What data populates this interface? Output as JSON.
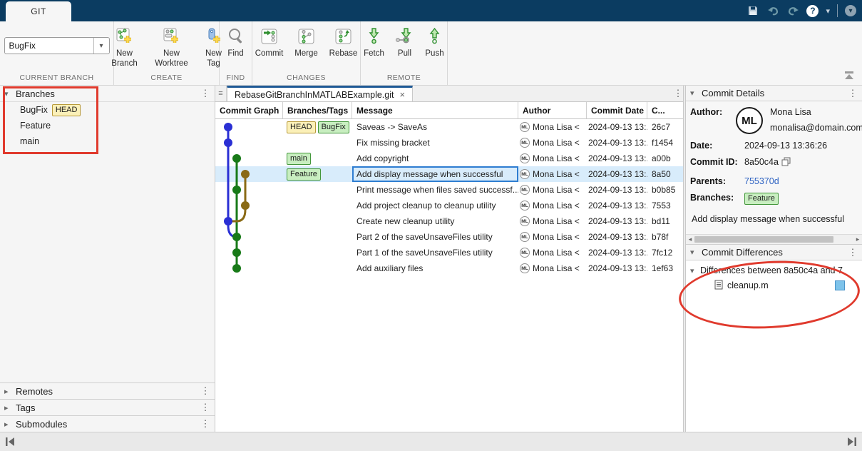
{
  "colors": {
    "navy": "#0b3c61",
    "accent": "#2e7dd1",
    "selbg": "#d8ecfb",
    "blue": "#2a2fd4",
    "green": "#187a18",
    "olive": "#8a6a15",
    "red": "#e03a2d",
    "linkblue": "#2d62c2",
    "headbg": "#fbf0b8",
    "headborder": "#b89a3a",
    "greenbg": "#c8eec0",
    "greenborder": "#43973b"
  },
  "icons": {
    "menu": "⋮",
    "collapse": "▾",
    "expand": "▸",
    "doc_bar": "≡",
    "close": "×",
    "caret": "▾",
    "help_q": "?",
    "scroll_left": "◂",
    "scroll_right": "▸"
  },
  "titlebar": {
    "tab_label": "GIT"
  },
  "toolstrip": {
    "branch_value": "BugFix",
    "group_current_branch": "CURRENT BRANCH",
    "btn_new_branch": "New Branch",
    "btn_new_worktree": "New Worktree",
    "btn_new_tag": "New Tag",
    "group_create": "CREATE",
    "btn_find": "Find",
    "group_find": "FIND",
    "btn_commit": "Commit",
    "btn_merge": "Merge",
    "btn_rebase": "Rebase",
    "group_changes": "CHANGES",
    "btn_fetch": "Fetch",
    "btn_pull": "Pull",
    "btn_push": "Push",
    "group_remote": "REMOTE"
  },
  "sidebar": {
    "branches_title": "Branches",
    "items": [
      {
        "name": "BugFix",
        "badge": "HEAD"
      },
      {
        "name": "Feature"
      },
      {
        "name": "main"
      }
    ],
    "collapsed_sections": [
      "Remotes",
      "Tags",
      "Submodules"
    ]
  },
  "repo": {
    "tab_title": "RebaseGitBranchInMATLABExample.git"
  },
  "table": {
    "columns": [
      "Commit Graph",
      "Branches/Tags",
      "Message",
      "Author",
      "Commit Date",
      "C..."
    ],
    "author_initials": "ML",
    "rows": [
      {
        "badges": [
          {
            "label": "HEAD"
          },
          {
            "label": "BugFix"
          }
        ],
        "message": "Saveas -> SaveAs",
        "author": "Mona Lisa <",
        "date": "2024-09-13 13:...",
        "id": "26c7"
      },
      {
        "message": "Fix missing bracket",
        "author": "Mona Lisa <",
        "date": "2024-09-13 13:...",
        "id": "f1454"
      },
      {
        "badges": [
          {
            "label": "main"
          }
        ],
        "message": "Add copyright",
        "author": "Mona Lisa <",
        "date": "2024-09-13 13:...",
        "id": "a00b"
      },
      {
        "badges": [
          {
            "label": "Feature"
          }
        ],
        "message": "Add display message when successful",
        "author": "Mona Lisa <",
        "date": "2024-09-13 13:...",
        "id": "8a50",
        "selected": true
      },
      {
        "message": "Print message when files saved successf...",
        "author": "Mona Lisa <",
        "date": "2024-09-13 13:...",
        "id": "b0b85"
      },
      {
        "message": "Add project cleanup to cleanup utility",
        "author": "Mona Lisa <",
        "date": "2024-09-13 13:...",
        "id": "7553"
      },
      {
        "message": "Create new cleanup utility",
        "author": "Mona Lisa <",
        "date": "2024-09-13 13:...",
        "id": "bd11"
      },
      {
        "message": "Part 2 of the saveUnsaveFiles utility",
        "author": "Mona Lisa <",
        "date": "2024-09-13 13:...",
        "id": "b78f"
      },
      {
        "message": "Part 1 of the saveUnsaveFiles utility",
        "author": "Mona Lisa <",
        "date": "2024-09-13 13:...",
        "id": "7fc12"
      },
      {
        "message": "Add auxiliary files",
        "author": "Mona Lisa <",
        "date": "2024-09-13 13:...",
        "id": "1ef63"
      }
    ]
  },
  "details": {
    "title": "Commit Details",
    "author_label": "Author:",
    "author_name": "Mona Lisa",
    "author_email": "monalisa@domain.com",
    "avatar_initials": "ML",
    "date_label": "Date:",
    "date": "2024-09-13 13:36:26",
    "commit_id_label": "Commit ID:",
    "commit_id": "8a50c4a",
    "parents_label": "Parents:",
    "parents": "755370d",
    "branches_label": "Branches:",
    "branch_badge": "Feature",
    "message": "Add display message when successful"
  },
  "differences": {
    "title": "Commit Differences",
    "group": "Differences between 8a50c4a and 7",
    "file": "cleanup.m"
  }
}
